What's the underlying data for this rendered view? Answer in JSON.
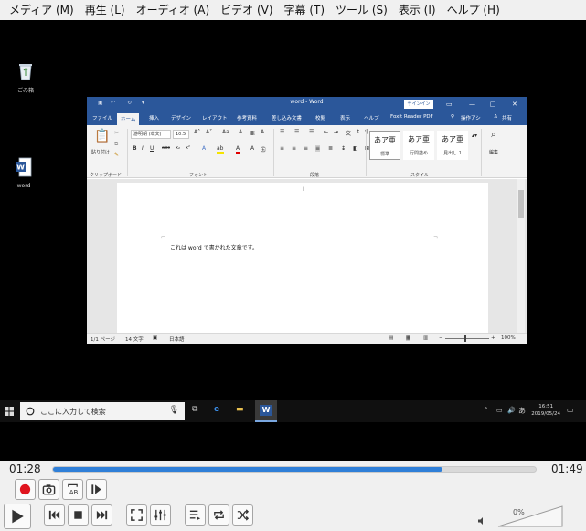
{
  "menu": [
    "メディア (M)",
    "再生 (L)",
    "オーディオ (A)",
    "ビデオ (V)",
    "字幕 (T)",
    "ツール (S)",
    "表示 (I)",
    "ヘルプ (H)"
  ],
  "desktop": {
    "recycle_label": "ごみ箱",
    "word_label": "word"
  },
  "word": {
    "title": "word - Word",
    "signin": "サインイン",
    "tabs": [
      "ファイル",
      "ホーム",
      "挿入",
      "デザイン",
      "レイアウト",
      "参考資料",
      "差し込み文書",
      "校閲",
      "表示",
      "ヘルプ",
      "Foxit Reader PDF",
      "操作アシ",
      "共有"
    ],
    "ribbon": {
      "clipboard_label": "クリップボード",
      "paste_label": "貼り付け",
      "font_name": "游明朝 (本文(",
      "font_size": "10.5",
      "font_group": "フォント",
      "paragraph_group": "段落",
      "style_group": "スタイル",
      "edit_label": "編集",
      "styles": [
        {
          "sample": "あア亜",
          "name": "標準"
        },
        {
          "sample": "あア亜",
          "name": "行間詰め"
        },
        {
          "sample": "あア亜",
          "name": "見出し 1"
        }
      ]
    },
    "document_text": "これは word で書かれた文章です。",
    "status": {
      "page": "1/1 ページ",
      "chars": "14 文字",
      "lang": "日本語",
      "zoom": "100%"
    }
  },
  "taskbar": {
    "search_placeholder": "ここに入力して検索",
    "time": "16:51",
    "date": "2019/05/24",
    "ime": "あ"
  },
  "player": {
    "elapsed": "01:28",
    "total": "01:49",
    "progress": 0.807,
    "volume": "0%"
  },
  "colors": {
    "accent": "#2f7fd8",
    "word_blue": "#2b579a",
    "record": "#e0141e"
  }
}
